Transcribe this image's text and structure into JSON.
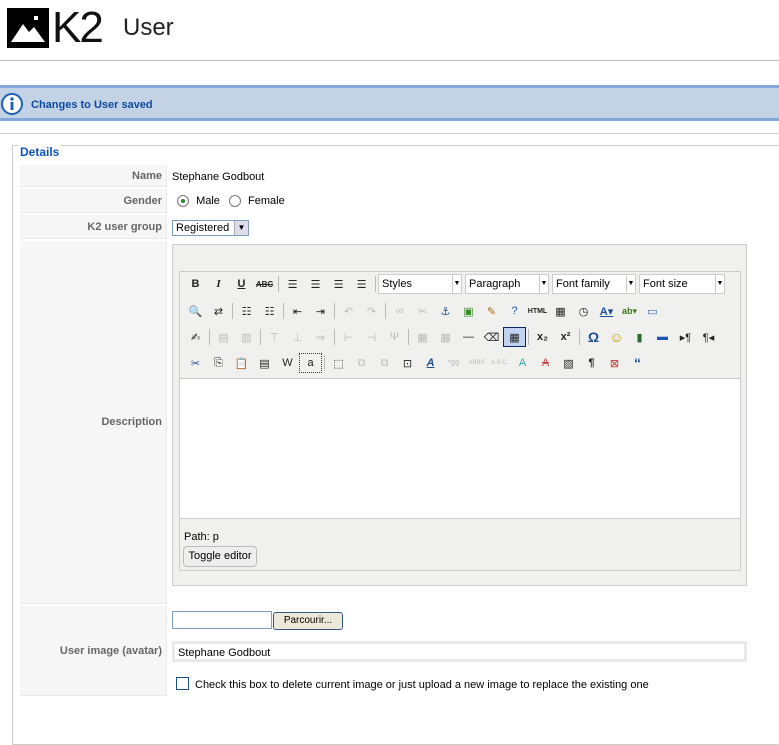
{
  "header": {
    "logo_text": "K2",
    "title": "User"
  },
  "message": {
    "text": "Changes to User saved",
    "icon": "info-icon"
  },
  "details": {
    "legend": "Details",
    "name_label": "Name",
    "name_value": "Stephane Godbout",
    "gender_label": "Gender",
    "gender_options": [
      "Male",
      "Female"
    ],
    "gender_selected": "Male",
    "group_label": "K2 user group",
    "group_value": "Registered",
    "description_label": "Description",
    "avatar_label": "User image (avatar)",
    "browse_label": "Parcourir...",
    "avatar_name": "Stephane Godbout",
    "delete_check_label": "Check this box to delete current image or just upload a new image to replace the existing one"
  },
  "editor": {
    "styles": "Styles",
    "format": "Paragraph",
    "font_family": "Font family",
    "font_size": "Font size",
    "path": "Path: p",
    "toggle_label": "Toggle editor"
  },
  "colors": {
    "message_bg": "#c3d2e5",
    "message_border": "#84a7db",
    "message_text": "#0c4a9e",
    "legend_text": "#0b55c4"
  }
}
